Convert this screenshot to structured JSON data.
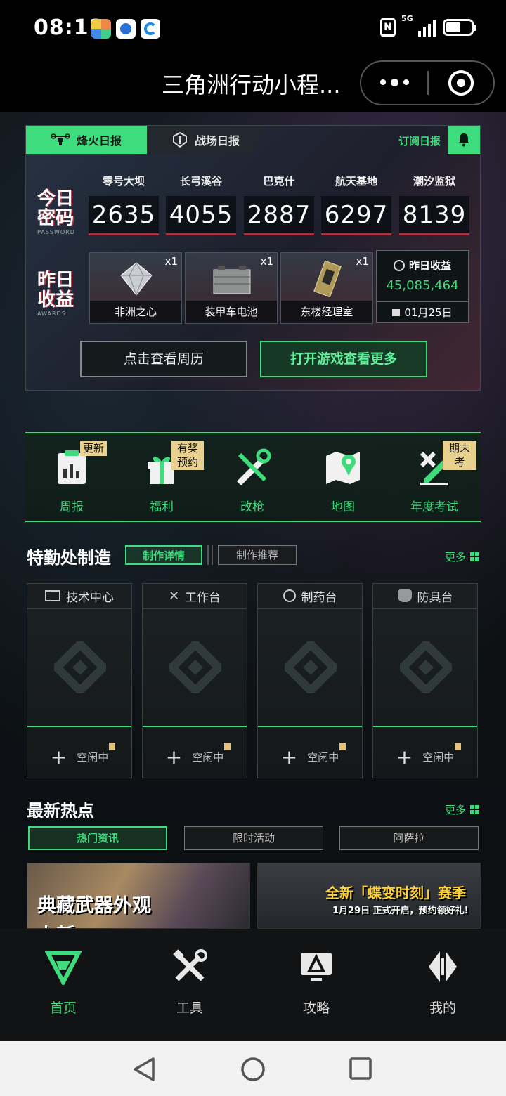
{
  "status_bar": {
    "time": "08:12",
    "network": "5G"
  },
  "title_bar": {
    "title": "三角洲行动小程..."
  },
  "daily": {
    "tabs": [
      "烽火日报",
      "战场日报"
    ],
    "subscribe_label": "订阅日报",
    "password_heading": "今日\n密码",
    "password_heading_en": "PASSWORD",
    "passwords": [
      {
        "map": "零号大坝",
        "code": "2635"
      },
      {
        "map": "长弓溪谷",
        "code": "4055"
      },
      {
        "map": "巴克什",
        "code": "2887"
      },
      {
        "map": "航天基地",
        "code": "6297"
      },
      {
        "map": "潮汐监狱",
        "code": "8139"
      }
    ],
    "awards_heading": "昨日\n收益",
    "awards_heading_en": "AWARDS",
    "awards": [
      {
        "name": "非洲之心",
        "count": "x1"
      },
      {
        "name": "装甲车电池",
        "count": "x1"
      },
      {
        "name": "东楼经理室",
        "count": "x1"
      }
    ],
    "yesterday": {
      "label": "昨日收益",
      "value": "45,085,464",
      "date": "01月25日"
    },
    "week_button": "点击查看周历",
    "game_button": "打开游戏查看更多"
  },
  "quick_menu": [
    {
      "label": "周报",
      "badge": "更新"
    },
    {
      "label": "福利",
      "badge": "有奖预约"
    },
    {
      "label": "改枪",
      "badge": ""
    },
    {
      "label": "地图",
      "badge": ""
    },
    {
      "label": "年度考试",
      "badge": "期末考"
    }
  ],
  "crafting": {
    "title": "特勤处制造",
    "tabs": [
      "制作详情",
      "制作推荐"
    ],
    "more": "更多",
    "stations": [
      {
        "name": "技术中心",
        "status": "空闲中"
      },
      {
        "name": "工作台",
        "status": "空闲中"
      },
      {
        "name": "制药台",
        "status": "空闲中"
      },
      {
        "name": "防具台",
        "status": "空闲中"
      }
    ]
  },
  "hot": {
    "title": "最新热点",
    "more": "更多",
    "tabs": [
      "热门资讯",
      "限时活动",
      "阿萨拉"
    ],
    "news": [
      {
        "caption": "典藏武器外观",
        "caption2": "上新"
      },
      {
        "caption": "全新「蝶变时刻」赛季",
        "caption2": "1月29日 正式开启，预约领好礼!"
      }
    ]
  },
  "tabbar": [
    {
      "label": "首页",
      "icon": "home-logo-icon"
    },
    {
      "label": "工具",
      "icon": "tools-icon"
    },
    {
      "label": "攻略",
      "icon": "guide-icon"
    },
    {
      "label": "我的",
      "icon": "profile-icon"
    }
  ],
  "colors": {
    "accent": "#3fdc7e",
    "badge": "#e8d08e",
    "alert_red": "#a83343"
  }
}
